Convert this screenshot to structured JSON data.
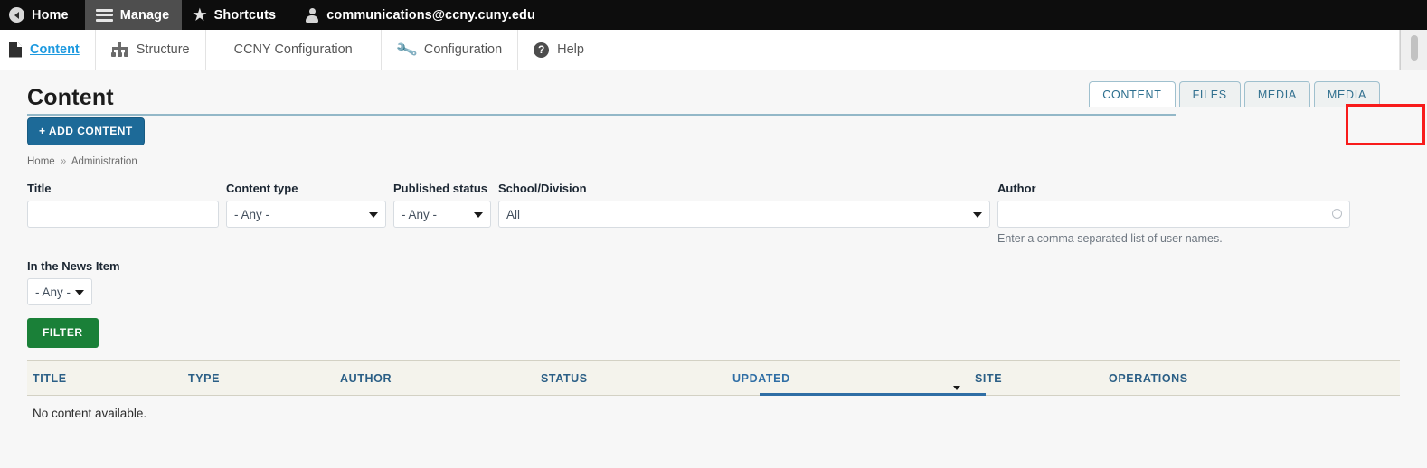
{
  "toolbar": {
    "items": [
      {
        "label": "Home",
        "icon": "back-arrow-icon",
        "active": false
      },
      {
        "label": "Manage",
        "icon": "hamburger-icon",
        "active": true
      },
      {
        "label": "Shortcuts",
        "icon": "star-icon",
        "active": false
      },
      {
        "label": "communications@ccny.cuny.edu",
        "icon": "user-icon",
        "active": false
      }
    ]
  },
  "tray": {
    "items": [
      {
        "label": "Content",
        "icon": "document-icon",
        "active": true
      },
      {
        "label": "Structure",
        "icon": "structure-icon",
        "active": false
      },
      {
        "label": "CCNY Configuration",
        "icon": "none",
        "active": false
      },
      {
        "label": "Configuration",
        "icon": "wrench-icon",
        "active": false
      },
      {
        "label": "Help",
        "icon": "help-icon",
        "active": false
      }
    ]
  },
  "page": {
    "title": "Content",
    "add_content_label": "+ ADD CONTENT",
    "breadcrumb": {
      "home": "Home",
      "separator": "»",
      "current": "Administration"
    }
  },
  "tabs": [
    {
      "label": "CONTENT",
      "active": true
    },
    {
      "label": "FILES",
      "active": false
    },
    {
      "label": "MEDIA",
      "active": false
    },
    {
      "label": "MEDIA",
      "active": false,
      "highlighted": true
    }
  ],
  "filters": {
    "title": {
      "label": "Title",
      "value": "",
      "placeholder": ""
    },
    "content_type": {
      "label": "Content type",
      "value": "- Any -"
    },
    "published_status": {
      "label": "Published status",
      "value": "- Any -"
    },
    "school_division": {
      "label": "School/Division",
      "value": "All"
    },
    "author": {
      "label": "Author",
      "value": "",
      "placeholder": "",
      "help": "Enter a comma separated list of user names."
    },
    "in_the_news_item": {
      "label": "In the News Item",
      "value": "- Any -"
    },
    "submit_label": "FILTER"
  },
  "table": {
    "columns": [
      {
        "label": "TITLE",
        "sorted": false
      },
      {
        "label": "TYPE",
        "sorted": false
      },
      {
        "label": "AUTHOR",
        "sorted": false
      },
      {
        "label": "STATUS",
        "sorted": false
      },
      {
        "label": "UPDATED",
        "sorted": true,
        "sort_direction": "desc"
      },
      {
        "label": "SITE",
        "sorted": false
      },
      {
        "label": "OPERATIONS",
        "sorted": false
      }
    ],
    "empty_message": "No content available."
  },
  "colors": {
    "toolbar_bg": "#0d0d0d",
    "toolbar_active_bg": "#4e4e4e",
    "link_blue": "#1e9ae0",
    "tab_blue": "#31708f",
    "add_button": "#1d6a98",
    "filter_button": "#1a8038",
    "highlight_red": "#f81b1b",
    "table_header_bg": "#f4f3ec",
    "sort_underline": "#2f6ea5"
  }
}
